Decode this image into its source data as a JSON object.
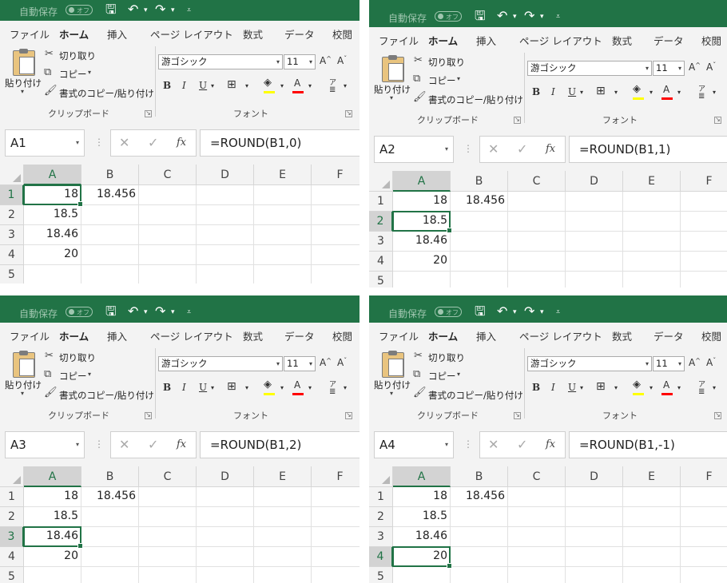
{
  "colors": {
    "accent": "#217346",
    "ribbon_bg": "#f3f3f3",
    "selected_header": "#d3d3d3"
  },
  "titlebar": {
    "autosave_label": "自動保存",
    "toggle_label": "オフ",
    "save_icon": "save-icon",
    "undo_icon": "undo-icon",
    "redo_icon": "redo-icon"
  },
  "tabs": [
    "ファイル",
    "ホーム",
    "挿入",
    "ページ レイアウト",
    "数式",
    "データ",
    "校閲"
  ],
  "active_tab": "ホーム",
  "ribbon": {
    "clipboard": {
      "paste_label": "貼り付け",
      "cut_label": "切り取り",
      "copy_label": "コピー",
      "format_painter_label": "書式のコピー/貼り付け",
      "group_label": "クリップボード"
    },
    "font": {
      "font_name": "游ゴシック",
      "font_size": "11",
      "group_label": "フォント",
      "bold": "B",
      "italic": "I",
      "underline": "U",
      "grow_font": "A",
      "shrink_font": "A",
      "phonetic": "ア",
      "highlight_color": "#ffff00",
      "font_color": "#ff0000"
    }
  },
  "columns": [
    "A",
    "B",
    "C",
    "D",
    "E",
    "F"
  ],
  "rows": [
    "1",
    "2",
    "3",
    "4",
    "5"
  ],
  "cells": {
    "A1": "18",
    "B1": "18.456",
    "A2": "18.5",
    "A3": "18.46",
    "A4": "20"
  },
  "panels": [
    {
      "namebox": "A1",
      "formula": "=ROUND(B1,0)"
    },
    {
      "namebox": "A2",
      "formula": "=ROUND(B1,1)"
    },
    {
      "namebox": "A3",
      "formula": "=ROUND(B1,2)"
    },
    {
      "namebox": "A4",
      "formula": "=ROUND(B1,-1)"
    }
  ]
}
